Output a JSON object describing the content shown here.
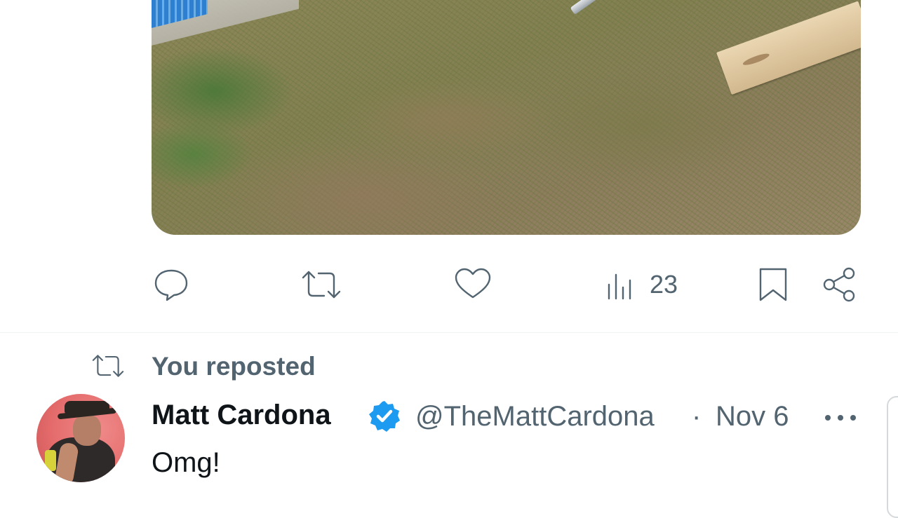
{
  "post_actions": {
    "views_count": "23"
  },
  "repost": {
    "label": "You reposted"
  },
  "tweet": {
    "display_name": "Matt Cardona",
    "handle": "@TheMattCardona",
    "separator": "·",
    "date": "Nov 6",
    "text": "Omg!",
    "verified": true
  },
  "icons": {
    "reply": "reply-icon",
    "repost": "repost-icon",
    "like": "heart-icon",
    "views": "views-icon",
    "bookmark": "bookmark-icon",
    "share": "share-icon",
    "verified": "verified-badge-icon",
    "more": "more-icon"
  },
  "colors": {
    "text_primary": "#0f1419",
    "text_secondary": "#536471",
    "verified_blue": "#1d9bf0",
    "divider": "#eff3f4"
  }
}
